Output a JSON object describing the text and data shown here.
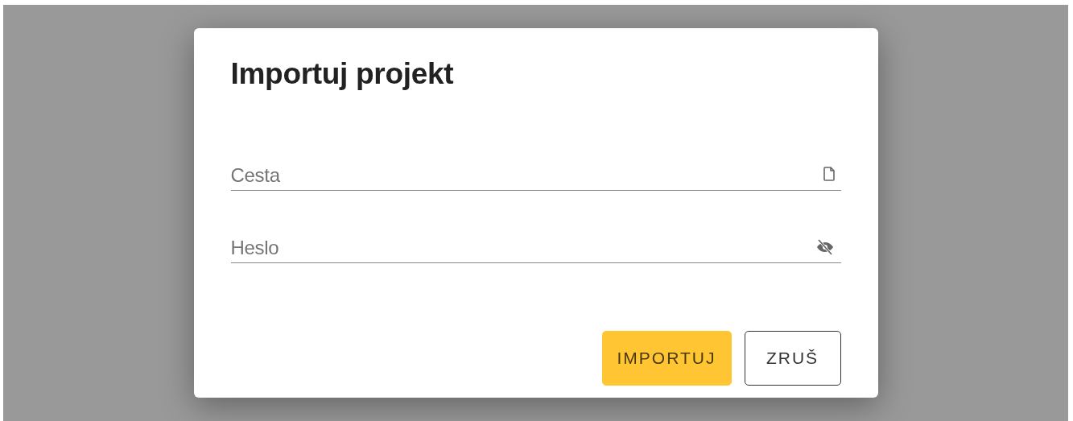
{
  "dialog": {
    "title": "Importuj projekt",
    "fields": [
      {
        "kind": "file",
        "placeholder": "Cesta"
      },
      {
        "kind": "password",
        "placeholder": "Heslo"
      }
    ],
    "buttons": [
      {
        "label": "IMPORTUJ",
        "primary": true
      },
      {
        "label": "ZRUŠ",
        "primary": false
      }
    ]
  }
}
